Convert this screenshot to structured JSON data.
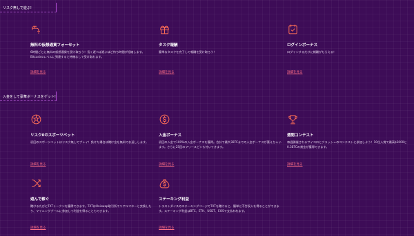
{
  "sections": [
    {
      "header": "リスク無しで遊ぶ!"
    },
    {
      "header": "入金をして豪華ボーナスをゲット!"
    }
  ],
  "accent_color": "#ff6f86",
  "icon_color": "#ff6f56",
  "link_label": "詳細を見る",
  "cards": [
    {
      "icon": "faucet-icon",
      "title": "無料の仮想通貨フォーセット",
      "desc": "6時間ごとに無料の仮想通貨を受け取ろう！長く遊べば遊ぶほど待ち時間が短縮します。Bitcasinoレベルに到達すると待機なしで受け取れます。"
    },
    {
      "icon": "gift-icon",
      "title": "タスク報酬",
      "desc": "簡単なタスクを完了して報酬を受け取ろう！"
    },
    {
      "icon": "calendar-check-icon",
      "title": "ログインボーナス",
      "desc": "ログインするだけに報酬がもらえる！"
    },
    {
      "icon": "ball-icon",
      "title": "リスク0のスポーツベット",
      "desc": "初回のスポーツベットはリスク無しでプレイ！負けた場合は賭け金を無料でお返しします。"
    },
    {
      "icon": "dollar-coin-icon",
      "title": "入金ボーナス",
      "desc": "初回の入金で100%の入金ボーナスを獲得。合計で最大3BTCまでの入金ボーナスが貰えちゃいます。さらに25回のフリースピンも付いてきます。"
    },
    {
      "icon": "trophy-icon",
      "title": "週間コンテスト",
      "desc": "毎週開催されるサイコロとクラッシュのコンテストに参加しよう！10位入賞で最高$3000と0.3BTCの賞金が獲得できます。"
    },
    {
      "icon": "swap-arrows-icon",
      "title": "遊んで稼ぐ",
      "desc": "賭けるたびにTXTトークンを獲得できます。TXTはUniswap取引所でリアルマネーと交換したり、マイニングプールに参加して利益を得ることもできます。"
    },
    {
      "icon": "money-bag-icon",
      "title": "ステーキング利益",
      "desc": "トラストダイスのステーキングページでTXTを賭けると、簡単に不労収入を得ることができます。ステーキング利益はBTC、ETH、USDT、EOSで支払われます。"
    }
  ]
}
